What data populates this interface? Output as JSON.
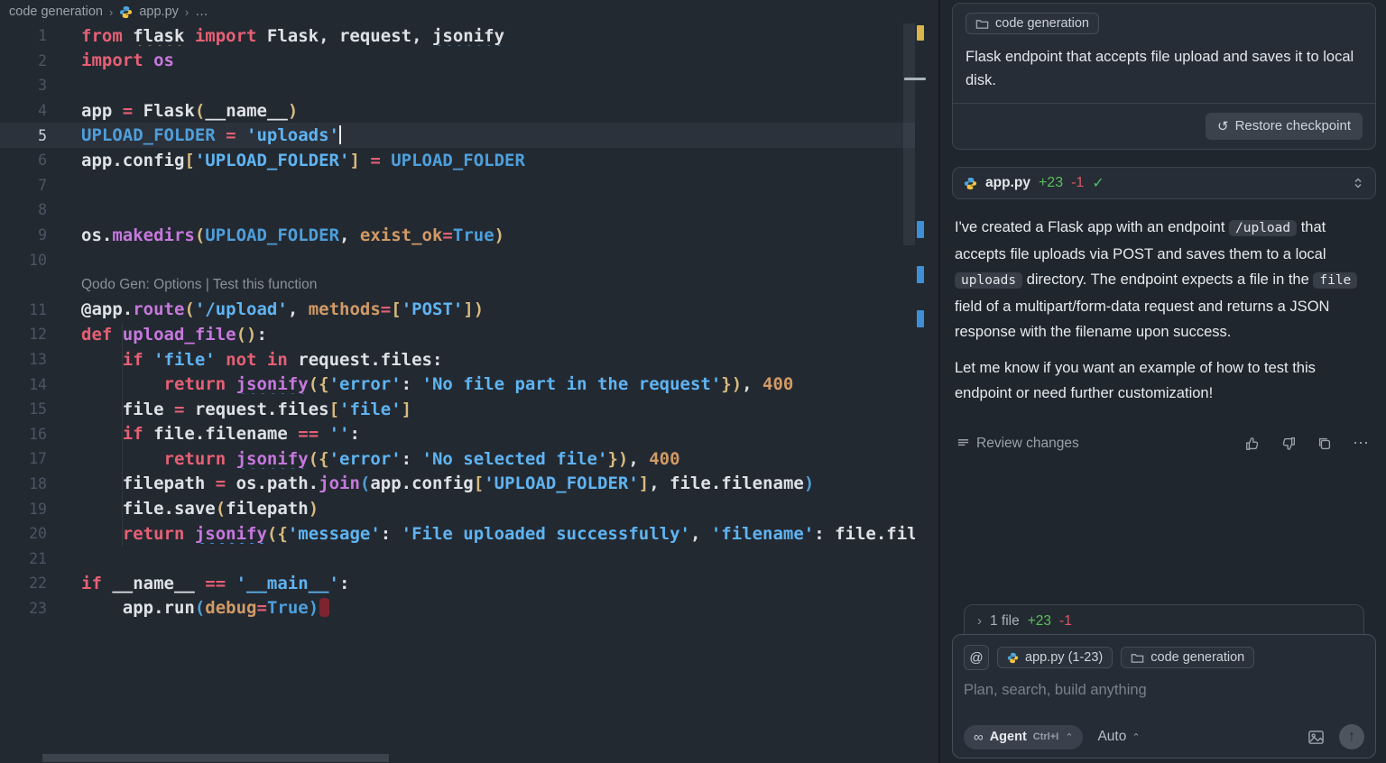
{
  "window": {
    "breadcrumb": {
      "folder": "code generation",
      "file": "app.py",
      "ellipsis": "…"
    }
  },
  "editor": {
    "codelens": "Qodo Gen: Options | Test this function",
    "lines": [
      {
        "n": 1,
        "tokens": [
          [
            "k",
            "from "
          ],
          [
            "w sqy",
            "flask"
          ],
          [
            "k",
            " import "
          ],
          [
            "w",
            "Flask, request, "
          ],
          [
            "w sqb",
            "jsonify"
          ]
        ]
      },
      {
        "n": 2,
        "tokens": [
          [
            "k",
            "import "
          ],
          [
            "fn",
            "os"
          ]
        ]
      },
      {
        "n": 3,
        "tokens": []
      },
      {
        "n": 4,
        "tokens": [
          [
            "w",
            "app "
          ],
          [
            "op",
            "= "
          ],
          [
            "w",
            "Flask"
          ],
          [
            "b",
            "("
          ],
          [
            "w",
            "__name__"
          ],
          [
            "b",
            ")"
          ]
        ]
      },
      {
        "n": 5,
        "current": true,
        "tokens": [
          [
            "c",
            "UPLOAD_FOLDER "
          ],
          [
            "op",
            "= "
          ],
          [
            "s",
            "'uploads'"
          ],
          [
            "cur",
            ""
          ]
        ]
      },
      {
        "n": 6,
        "tokens": [
          [
            "w",
            "app.config"
          ],
          [
            "b",
            "["
          ],
          [
            "s",
            "'UPLOAD_FOLDER'"
          ],
          [
            "b",
            "]"
          ],
          [
            "op",
            " = "
          ],
          [
            "c",
            "UPLOAD_FOLDER"
          ]
        ]
      },
      {
        "n": 7,
        "tokens": []
      },
      {
        "n": 8,
        "tokens": []
      },
      {
        "n": 9,
        "tokens": [
          [
            "w",
            "os."
          ],
          [
            "fn",
            "makedirs"
          ],
          [
            "b",
            "("
          ],
          [
            "c",
            "UPLOAD_FOLDER"
          ],
          [
            "w",
            ", "
          ],
          [
            "a",
            "exist_ok"
          ],
          [
            "op",
            "="
          ],
          [
            "c",
            "True"
          ],
          [
            "b",
            ")"
          ]
        ]
      },
      {
        "n": 10,
        "tokens": []
      },
      {
        "codelens": true
      },
      {
        "n": 11,
        "tokens": [
          [
            "w",
            "@app."
          ],
          [
            "fn",
            "route"
          ],
          [
            "b",
            "("
          ],
          [
            "s",
            "'/upload'"
          ],
          [
            "w",
            ", "
          ],
          [
            "a",
            "methods"
          ],
          [
            "op",
            "="
          ],
          [
            "b",
            "["
          ],
          [
            "s",
            "'POST'"
          ],
          [
            "b",
            "]"
          ],
          [
            "b",
            ")"
          ]
        ]
      },
      {
        "n": 12,
        "tokens": [
          [
            "k",
            "def "
          ],
          [
            "fn",
            "upload_file"
          ],
          [
            "b",
            "()"
          ],
          [
            "w",
            ":"
          ]
        ]
      },
      {
        "n": 13,
        "tokens": [
          [
            "w",
            "    "
          ],
          [
            "k",
            "if "
          ],
          [
            "s",
            "'file'"
          ],
          [
            "k",
            " not in "
          ],
          [
            "w",
            "request.files:"
          ]
        ]
      },
      {
        "n": 14,
        "tokens": [
          [
            "w",
            "        "
          ],
          [
            "k",
            "return "
          ],
          [
            "fn sqb",
            "jsonify"
          ],
          [
            "b",
            "({"
          ],
          [
            "s",
            "'error'"
          ],
          [
            "w",
            ": "
          ],
          [
            "s",
            "'No file part in the request'"
          ],
          [
            "b",
            "})"
          ],
          [
            "w",
            ", "
          ],
          [
            "n2",
            "400"
          ]
        ]
      },
      {
        "n": 15,
        "tokens": [
          [
            "w",
            "    file "
          ],
          [
            "op",
            "= "
          ],
          [
            "w",
            "request.files"
          ],
          [
            "b",
            "["
          ],
          [
            "s",
            "'file'"
          ],
          [
            "b",
            "]"
          ]
        ]
      },
      {
        "n": 16,
        "tokens": [
          [
            "w",
            "    "
          ],
          [
            "k",
            "if "
          ],
          [
            "w",
            "file.filename "
          ],
          [
            "op",
            "== "
          ],
          [
            "s",
            "''"
          ],
          [
            "w",
            ":"
          ]
        ]
      },
      {
        "n": 17,
        "tokens": [
          [
            "w",
            "        "
          ],
          [
            "k",
            "return "
          ],
          [
            "fn sqb",
            "jsonify"
          ],
          [
            "b",
            "({"
          ],
          [
            "s",
            "'error'"
          ],
          [
            "w",
            ": "
          ],
          [
            "s",
            "'No selected file'"
          ],
          [
            "b",
            "})"
          ],
          [
            "w",
            ", "
          ],
          [
            "n2",
            "400"
          ]
        ]
      },
      {
        "n": 18,
        "tokens": [
          [
            "w",
            "    filepath "
          ],
          [
            "op",
            "= "
          ],
          [
            "w",
            "os.path."
          ],
          [
            "fn sqb",
            "join"
          ],
          [
            "b2",
            "("
          ],
          [
            "w",
            "app.config"
          ],
          [
            "b",
            "["
          ],
          [
            "s",
            "'UPLOAD_FOLDER'"
          ],
          [
            "b",
            "]"
          ],
          [
            "w",
            ", file.filename"
          ],
          [
            "b2",
            ")"
          ]
        ]
      },
      {
        "n": 19,
        "tokens": [
          [
            "w",
            "    file.save"
          ],
          [
            "b",
            "("
          ],
          [
            "w",
            "filepath"
          ],
          [
            "b",
            ")"
          ]
        ]
      },
      {
        "n": 20,
        "tokens": [
          [
            "w",
            "    "
          ],
          [
            "k",
            "return "
          ],
          [
            "fn sqb",
            "jsonify"
          ],
          [
            "b",
            "({"
          ],
          [
            "s",
            "'message'"
          ],
          [
            "w",
            ": "
          ],
          [
            "s",
            "'File uploaded successfully'"
          ],
          [
            "w",
            ", "
          ],
          [
            "s",
            "'filename'"
          ],
          [
            "w",
            ": file.filena"
          ]
        ]
      },
      {
        "n": 21,
        "tokens": []
      },
      {
        "n": 22,
        "tokens": [
          [
            "k",
            "if "
          ],
          [
            "w",
            "__name__ "
          ],
          [
            "op",
            "== "
          ],
          [
            "s",
            "'__main__'"
          ],
          [
            "w",
            ":"
          ]
        ]
      },
      {
        "n": 23,
        "tokens": [
          [
            "w",
            "    app.run"
          ],
          [
            "b2",
            "("
          ],
          [
            "a",
            "debug"
          ],
          [
            "op",
            "="
          ],
          [
            "c",
            "True"
          ],
          [
            "b2",
            ")"
          ],
          [
            "rm",
            ""
          ]
        ]
      }
    ]
  },
  "panel": {
    "task_card": {
      "chip": "code generation",
      "prompt": "Flask endpoint that accepts file upload and saves it to local disk.",
      "restore_label": "Restore checkpoint"
    },
    "file_card": {
      "name": "app.py",
      "added": "+23",
      "removed": "-1",
      "check": "✓"
    },
    "message": {
      "p1": [
        {
          "t": "text",
          "v": "I've created a Flask app with an endpoint "
        },
        {
          "t": "code",
          "v": "/upload"
        },
        {
          "t": "text",
          "v": " that accepts file uploads via POST and saves them to a local "
        },
        {
          "t": "code",
          "v": "uploads"
        },
        {
          "t": "text",
          "v": " directory. The endpoint expects a file in the "
        },
        {
          "t": "code",
          "v": "file"
        },
        {
          "t": "text",
          "v": " field of a multipart/form-data request and returns a JSON response with the filename upon success."
        }
      ],
      "p2": "Let me know if you want an example of how to test this endpoint or need further customization!"
    },
    "review": {
      "label": "Review changes",
      "more": "⋯"
    },
    "files_bar": {
      "chevron": "›",
      "label": "1 file",
      "added": "+23",
      "removed": "-1"
    },
    "composer": {
      "at": "@",
      "file_chip": "app.py (1-23)",
      "context_chip": "code generation",
      "placeholder": "Plan, search, build anything",
      "agent_infinity": "∞",
      "agent": "Agent",
      "shortcut": "Ctrl+I",
      "agent_chevron": "⌃",
      "mode": "Auto",
      "mode_chevron": "⌃",
      "send_arrow": "↑"
    }
  },
  "colors": {
    "added": "#57c15a",
    "removed": "#e05561",
    "warning": "#d9b54a",
    "info": "#3f8fd6",
    "string_blue": "#5fb4f2",
    "keyword_pink": "#e56075"
  }
}
